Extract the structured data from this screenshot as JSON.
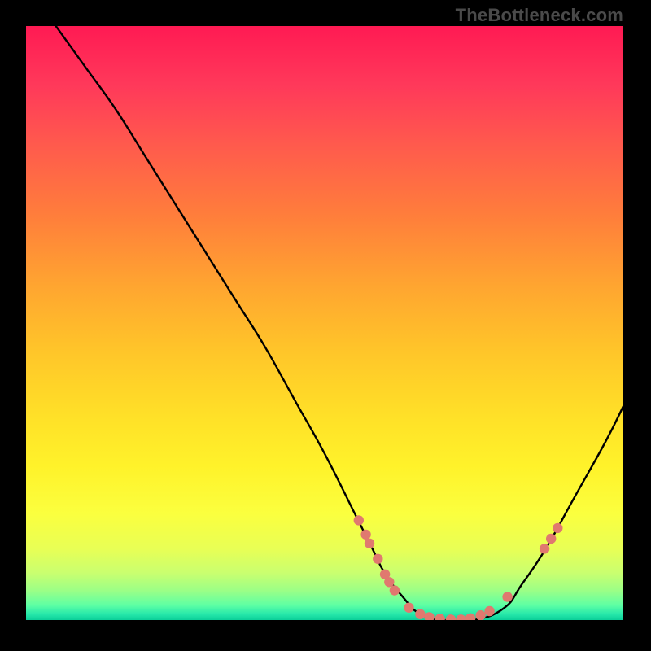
{
  "watermark": "TheBottleneck.com",
  "chart_data": {
    "type": "line",
    "title": "",
    "xlabel": "",
    "ylabel": "",
    "xlim": [
      0,
      100
    ],
    "ylim": [
      0,
      100
    ],
    "grid": false,
    "series": [
      {
        "name": "curve",
        "x": [
          5,
          10,
          15,
          20,
          25,
          30,
          35,
          40,
          45,
          50,
          55,
          58,
          60,
          63,
          66,
          70,
          75,
          80,
          83,
          87,
          92,
          97,
          100
        ],
        "y": [
          100,
          93,
          86,
          78,
          70,
          62,
          54,
          46,
          37,
          28,
          18,
          12,
          8,
          4,
          1,
          0,
          0,
          2,
          6,
          12,
          21,
          30,
          36
        ]
      }
    ],
    "markers": [
      {
        "x": 55.7,
        "y": 16.8
      },
      {
        "x": 56.9,
        "y": 14.4
      },
      {
        "x": 57.5,
        "y": 12.9
      },
      {
        "x": 58.9,
        "y": 10.3
      },
      {
        "x": 60.1,
        "y": 7.7
      },
      {
        "x": 60.8,
        "y": 6.4
      },
      {
        "x": 61.7,
        "y": 5.0
      },
      {
        "x": 64.1,
        "y": 2.1
      },
      {
        "x": 66.0,
        "y": 1.0
      },
      {
        "x": 67.5,
        "y": 0.5
      },
      {
        "x": 69.3,
        "y": 0.2
      },
      {
        "x": 71.1,
        "y": 0.1
      },
      {
        "x": 72.8,
        "y": 0.1
      },
      {
        "x": 74.4,
        "y": 0.3
      },
      {
        "x": 76.1,
        "y": 0.8
      },
      {
        "x": 77.6,
        "y": 1.5
      },
      {
        "x": 80.6,
        "y": 3.9
      },
      {
        "x": 86.8,
        "y": 12.0
      },
      {
        "x": 87.9,
        "y": 13.7
      },
      {
        "x": 89.0,
        "y": 15.5
      }
    ],
    "gradient_stops": [
      {
        "pct": 0,
        "color": "#ff1a53"
      },
      {
        "pct": 10,
        "color": "#ff395a"
      },
      {
        "pct": 20,
        "color": "#ff5a4d"
      },
      {
        "pct": 32,
        "color": "#ff7e3b"
      },
      {
        "pct": 44,
        "color": "#ffa630"
      },
      {
        "pct": 55,
        "color": "#ffc629"
      },
      {
        "pct": 66,
        "color": "#ffe128"
      },
      {
        "pct": 74,
        "color": "#fff22a"
      },
      {
        "pct": 82,
        "color": "#fbff3e"
      },
      {
        "pct": 88,
        "color": "#e8ff55"
      },
      {
        "pct": 92,
        "color": "#caff6f"
      },
      {
        "pct": 95,
        "color": "#9cff86"
      },
      {
        "pct": 97.5,
        "color": "#5effa4"
      },
      {
        "pct": 99,
        "color": "#27e8aa"
      },
      {
        "pct": 100,
        "color": "#0bcf99"
      }
    ],
    "marker_color": "#e0796f",
    "line_color": "#000000"
  }
}
